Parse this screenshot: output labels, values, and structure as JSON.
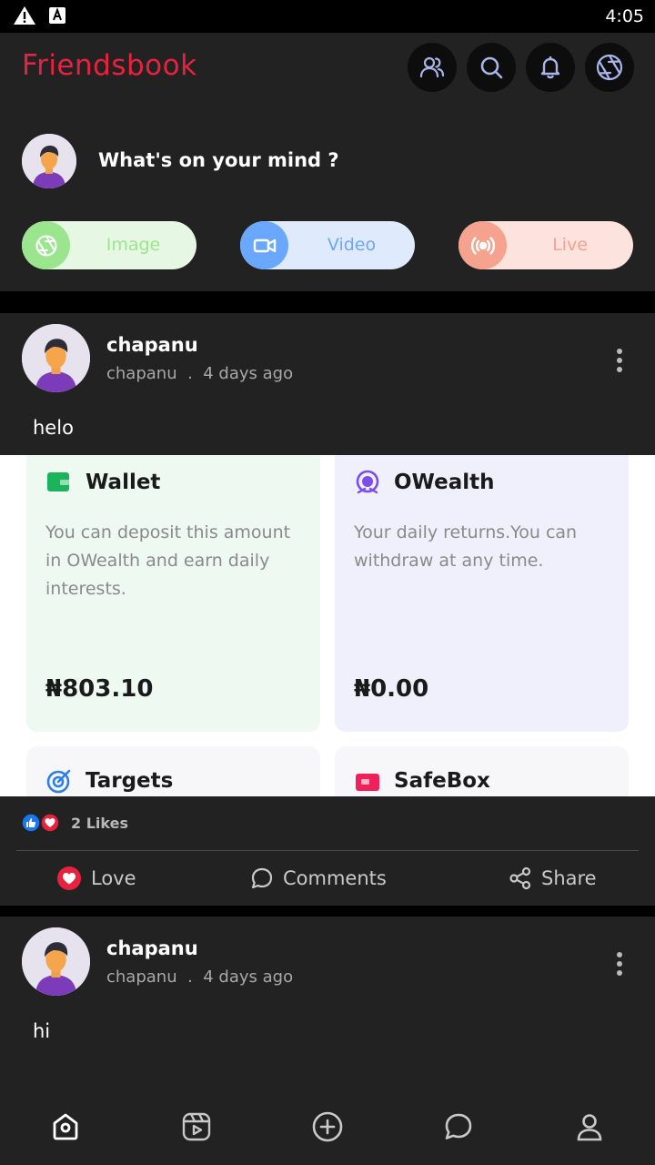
{
  "status_bar": {
    "time": "4:05"
  },
  "app": {
    "title": "Friendsbook"
  },
  "header_icons": [
    "friends-icon",
    "search-icon",
    "bell-icon",
    "aperture-icon"
  ],
  "composer": {
    "prompt": "What's on your mind ?",
    "buttons": [
      {
        "label": "Image",
        "icon": "aperture-icon",
        "color": "#9be58f",
        "bg": "#e6f7e3"
      },
      {
        "label": "Video",
        "icon": "video-icon",
        "color": "#6aa8ff",
        "bg": "#dfeafc"
      },
      {
        "label": "Live",
        "icon": "broadcast-icon",
        "color": "#f5a28e",
        "bg": "#fce3dd"
      }
    ]
  },
  "posts": [
    {
      "author": "chapanu",
      "username": "chapanu",
      "separator": ".",
      "time_ago": "4 days ago",
      "text": "helo",
      "image_cards": [
        {
          "title": "Wallet",
          "description": "You can deposit this amount in OWealth and earn daily interests.",
          "amount": "₦803.10"
        },
        {
          "title": "OWealth",
          "description": "Your daily returns.You can withdraw at any time.",
          "amount": "₦0.00"
        },
        {
          "title": "Targets"
        },
        {
          "title": "SafeBox"
        }
      ],
      "likes": "2 Likes",
      "actions": [
        "Love",
        "Comments",
        "Share"
      ]
    },
    {
      "author": "chapanu",
      "username": "chapanu",
      "separator": ".",
      "time_ago": "4 days ago",
      "text": "hi"
    }
  ],
  "bottom_nav": [
    "home-icon",
    "reels-icon",
    "add-icon",
    "chat-icon",
    "profile-icon"
  ],
  "colors": {
    "brand": "#e8213f",
    "surface": "#222222",
    "background": "#000000",
    "love": "#e8213f"
  }
}
